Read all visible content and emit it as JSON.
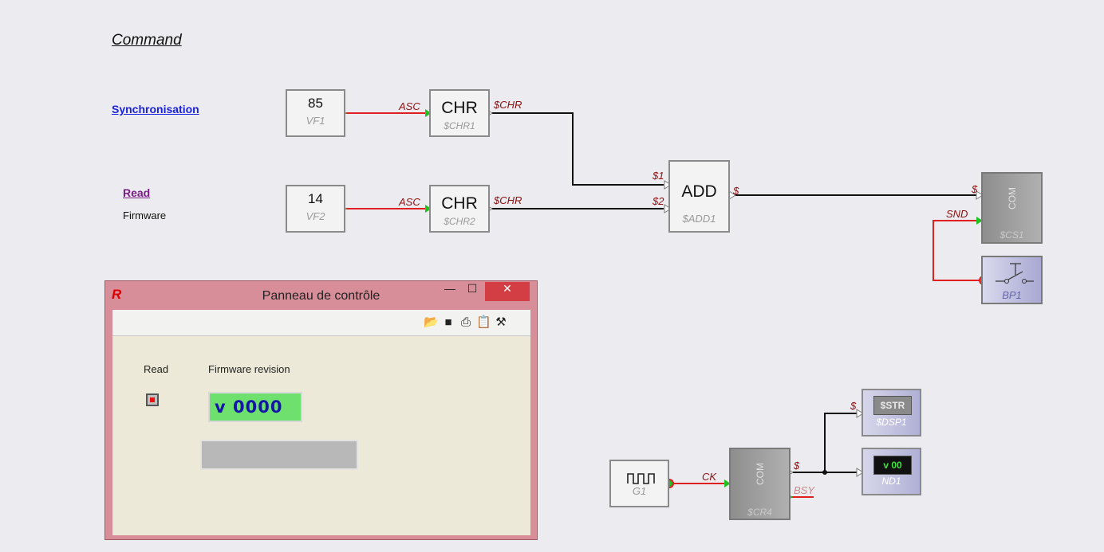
{
  "page": {
    "title": "Command",
    "links": {
      "synchronisation": "Synchronisation",
      "read": "Read",
      "firmware": "Firmware"
    }
  },
  "blocks": {
    "vf1": {
      "value": "85",
      "name": "VF1"
    },
    "vf2": {
      "value": "14",
      "name": "VF2"
    },
    "chr1": {
      "label": "CHR",
      "name": "$CHR1",
      "in": "ASC",
      "out": "$CHR"
    },
    "chr2": {
      "label": "CHR",
      "name": "$CHR2",
      "in": "ASC",
      "out": "$CHR"
    },
    "add1": {
      "label": "ADD",
      "name": "$ADD1",
      "in1": "$1",
      "in2": "$2",
      "out": "$"
    },
    "cs1": {
      "label": "COM",
      "name": "$CS1",
      "in": "$",
      "snd": "SND"
    },
    "bp1": {
      "name": "BP1"
    },
    "g1": {
      "name": "G1"
    },
    "cr4": {
      "label": "COM",
      "name": "$CR4",
      "ck": "CK",
      "out": "$",
      "bsy": "BSY"
    },
    "dsp1": {
      "display": "$STR",
      "name": "$DSP1",
      "in": "$"
    },
    "nd1": {
      "display": "v 00",
      "name": "ND1"
    }
  },
  "window": {
    "title": "Panneau de contrôle",
    "read_label": "Read",
    "fw_label": "Firmware revision",
    "fw_value": "v  0000",
    "icons": [
      "open-folder-icon",
      "save-icon",
      "print-icon",
      "clipboard-icon",
      "tools-icon"
    ]
  },
  "colors": {
    "wire_red": "#e02020",
    "wire_black": "#111111",
    "port_green": "#22c022",
    "link_blue": "#1a22dd",
    "link_purple": "#7a1a86",
    "window_frame": "#d78e98"
  }
}
